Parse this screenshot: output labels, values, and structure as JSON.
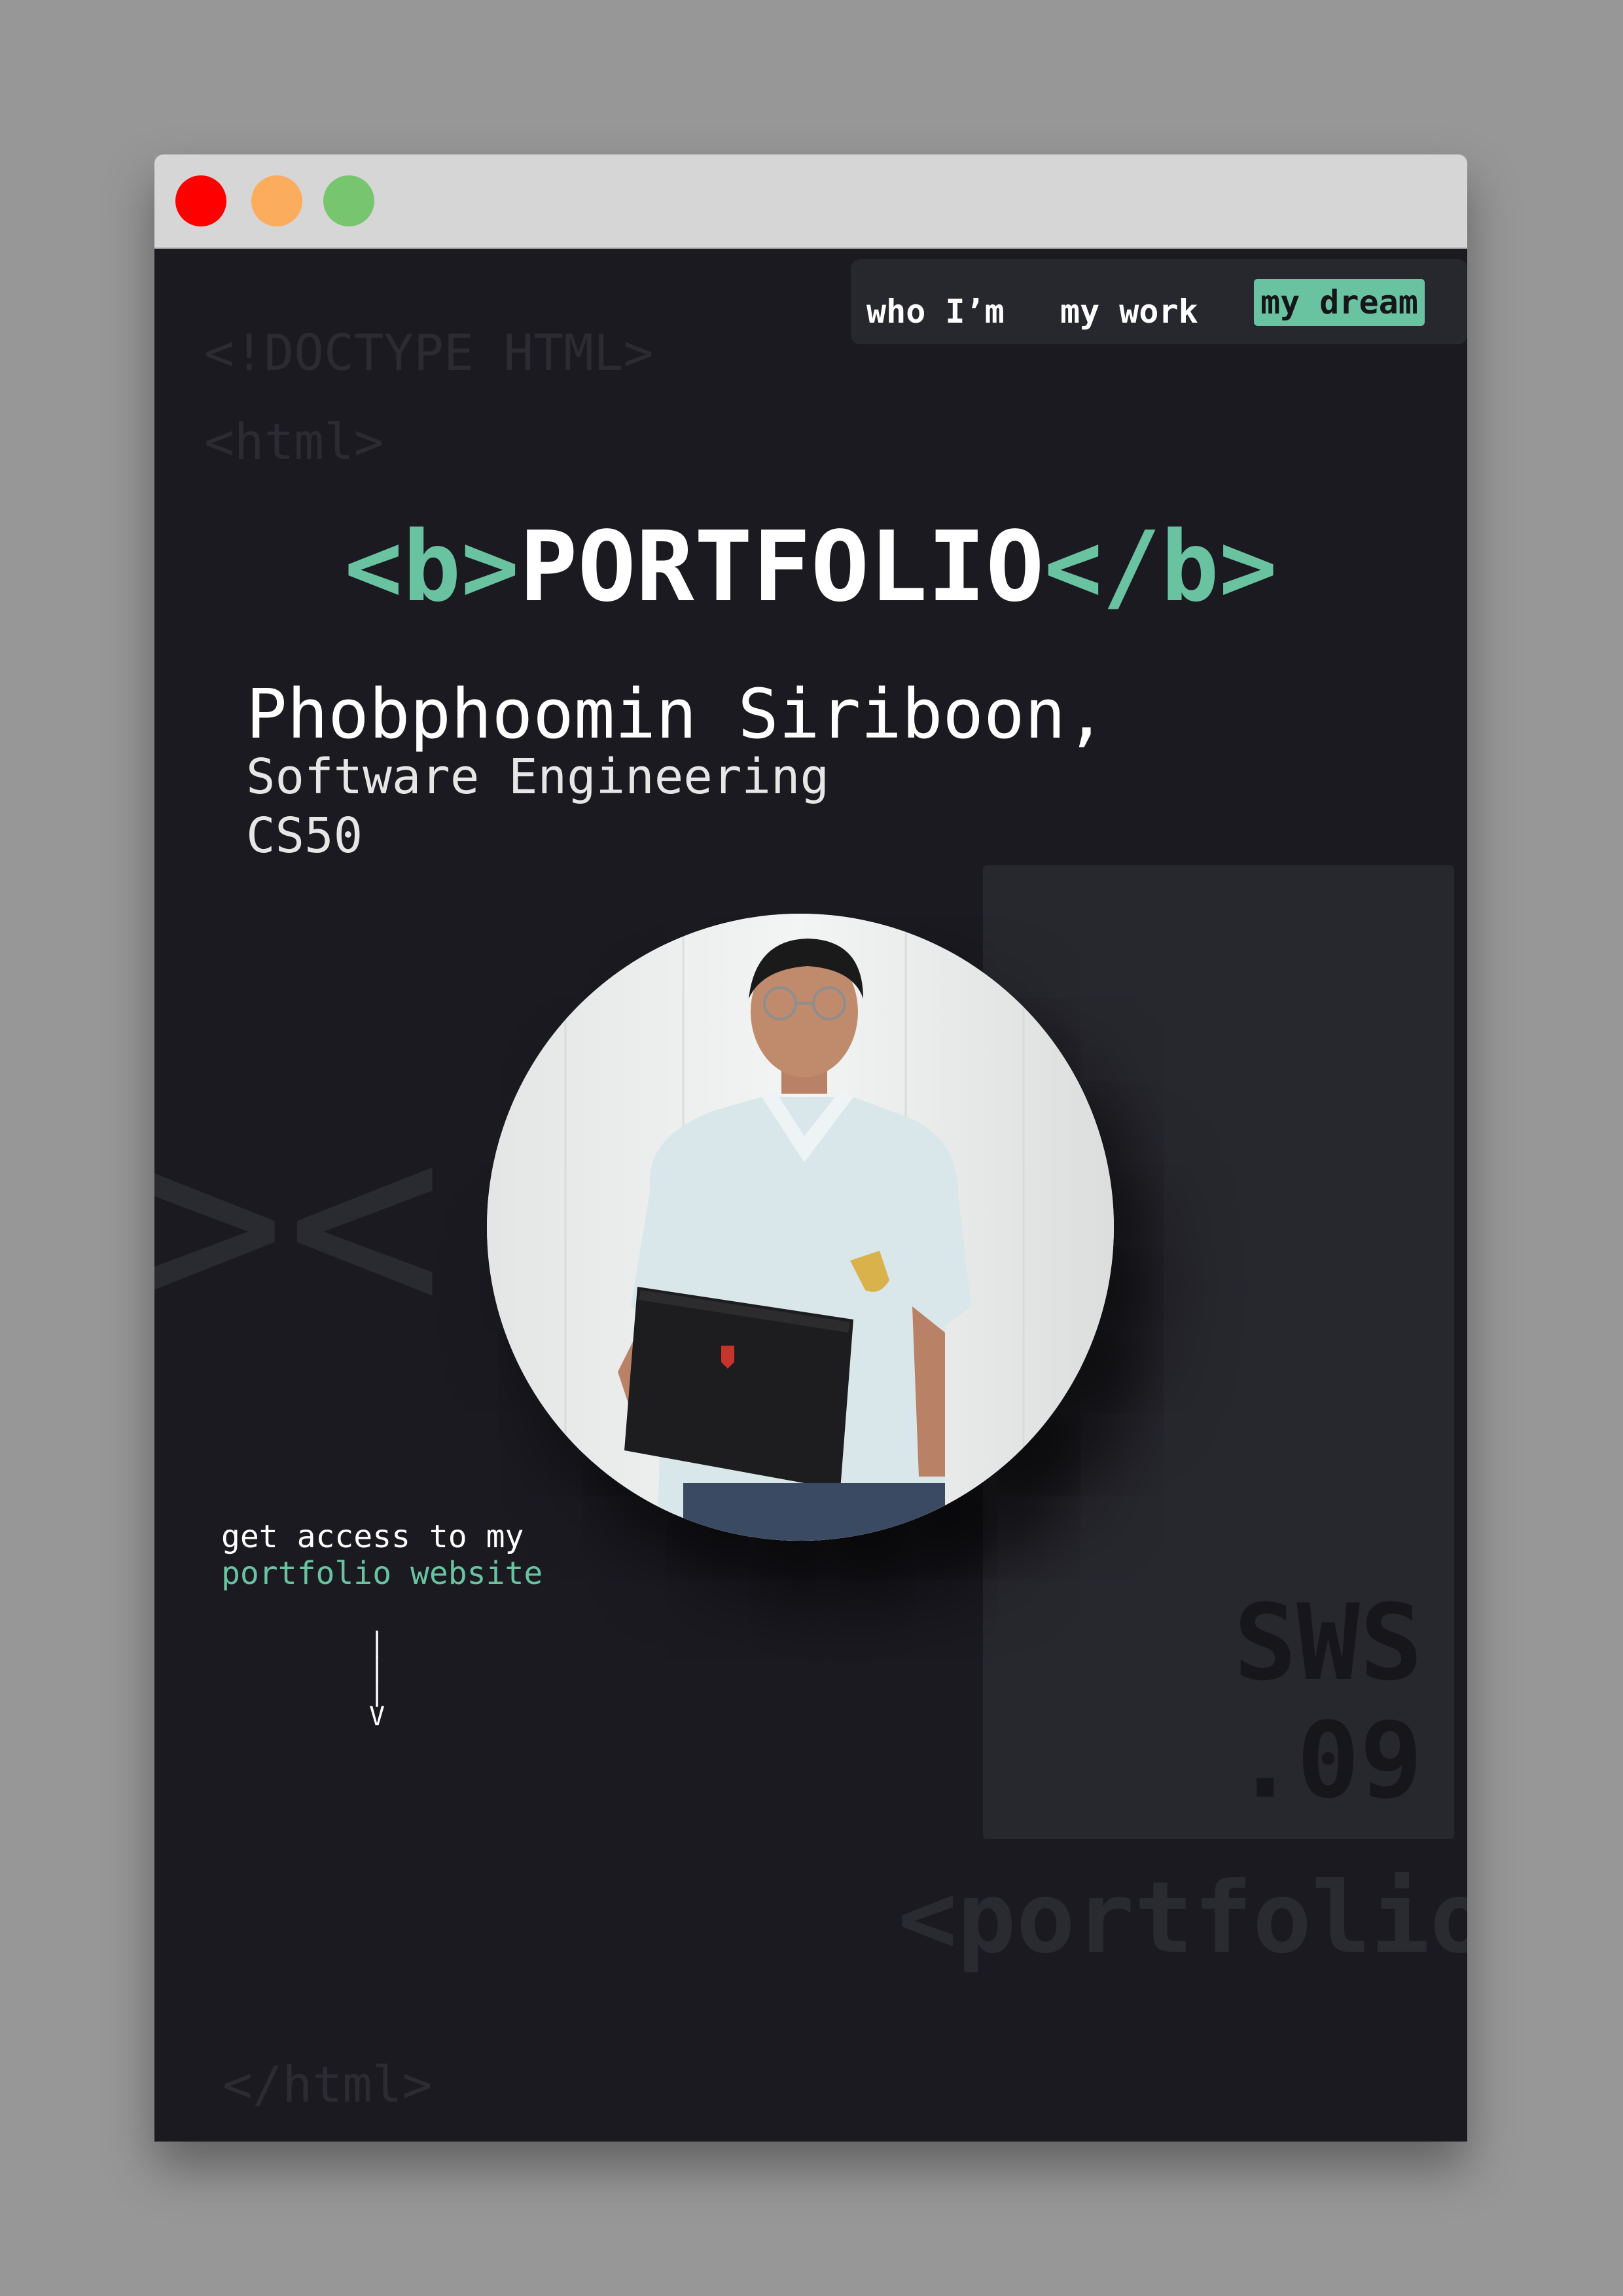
{
  "window": {
    "buttons": [
      "close",
      "minimize",
      "zoom"
    ],
    "colors": {
      "close": "#ff0000",
      "minimize": "#fbac5c",
      "zoom": "#77c56f"
    }
  },
  "nav": {
    "items": [
      {
        "label": "who I’m"
      },
      {
        "label": "my work"
      },
      {
        "label": "my dream",
        "active": true
      }
    ]
  },
  "background_code": {
    "doctype": "<!DOCTYPE HTML>",
    "html_open": "<html>",
    "html_close": "</html>",
    "portfolio_tag": "<portfolio",
    "brackets": "><"
  },
  "side_panel": {
    "line1": "SWS",
    "line2": ".09"
  },
  "hero": {
    "open_tag": "<b>",
    "title": "PORTFOLIO",
    "close_tag": "</b>"
  },
  "profile": {
    "name": "Phobphoomin Siriboon,",
    "role": "Software Engineering",
    "course": "CS50",
    "photo_icon": "profile-photo"
  },
  "cta": {
    "line1": "get access to my",
    "line2": "portfolio website",
    "arrow": "|\n|\n|\nV"
  },
  "colors": {
    "accent": "#69c3a1",
    "background": "#1b1a21",
    "panel": "#27272e"
  }
}
